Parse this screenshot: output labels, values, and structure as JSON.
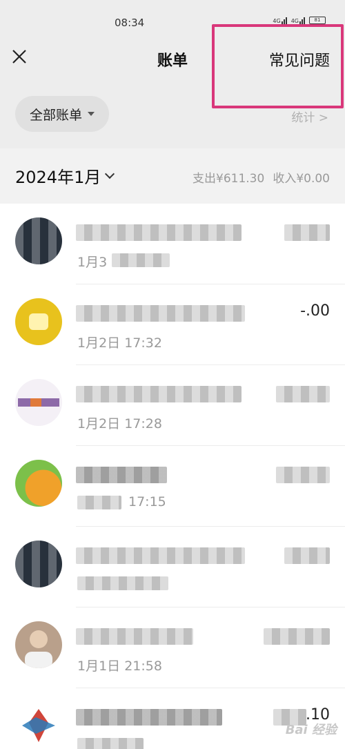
{
  "status_bar": {
    "time": "08:34",
    "network": "4G",
    "battery_label": "81"
  },
  "header": {
    "title": "账单",
    "faq_label": "常见问题",
    "close_icon": "close-icon"
  },
  "filter": {
    "label": "全部账单",
    "stats_label": "统计 >"
  },
  "month": {
    "label": "2024年1月",
    "expense": "支出¥611.30",
    "income": "收入¥0.00"
  },
  "transactions": [
    {
      "time": "1月3",
      "amount": "",
      "avatar_color": "#2b3440"
    },
    {
      "time": "1月2日 17:32",
      "amount": "-.00",
      "avatar_color": "#e8c21d"
    },
    {
      "time": "1月2日 17:28",
      "amount": "",
      "avatar_color": "#8d6aa8"
    },
    {
      "time": "17:15",
      "amount": "",
      "avatar_color": "#e29a2c"
    },
    {
      "time": "",
      "amount": "",
      "avatar_color": "#2b3440"
    },
    {
      "time": "1月1日 21:58",
      "amount": "",
      "avatar_color": "#b9a08b"
    },
    {
      "time": "",
      "amount": ".10",
      "avatar_color": "#d0453a"
    }
  ],
  "watermark": "Bai 经验",
  "colors": {
    "highlight": "#d9377a",
    "header_bg": "#ededed",
    "muted": "#999999"
  }
}
